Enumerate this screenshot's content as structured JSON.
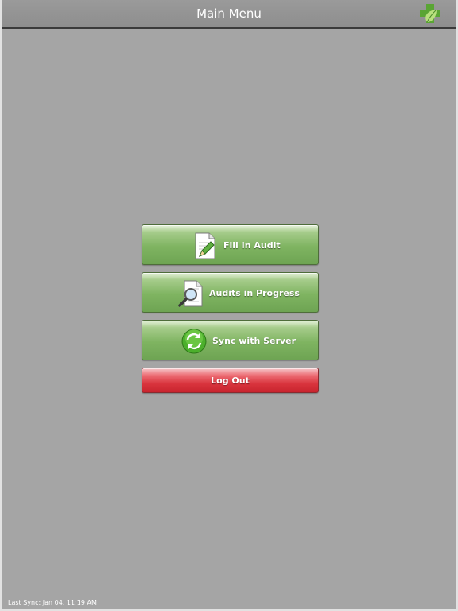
{
  "header": {
    "title": "Main Menu",
    "logo_icon": "green-cross-leaf-icon"
  },
  "menu": {
    "fill_in_audit": {
      "label": "Fill In Audit",
      "icon": "document-pencil-icon"
    },
    "audits_in_progress": {
      "label": "Audits in Progress",
      "icon": "document-magnifier-icon"
    },
    "sync_with_server": {
      "label": "Sync with Server",
      "icon": "sync-arrows-icon"
    },
    "log_out": {
      "label": "Log Out"
    }
  },
  "status": {
    "last_sync": "Last Sync: Jan 04, 11:19 AM"
  },
  "colors": {
    "background": "#a5a5a5",
    "topbar": "#949494",
    "button_green": "#7fb461",
    "button_red": "#d9343d",
    "logo_green": "#6cb33e"
  }
}
